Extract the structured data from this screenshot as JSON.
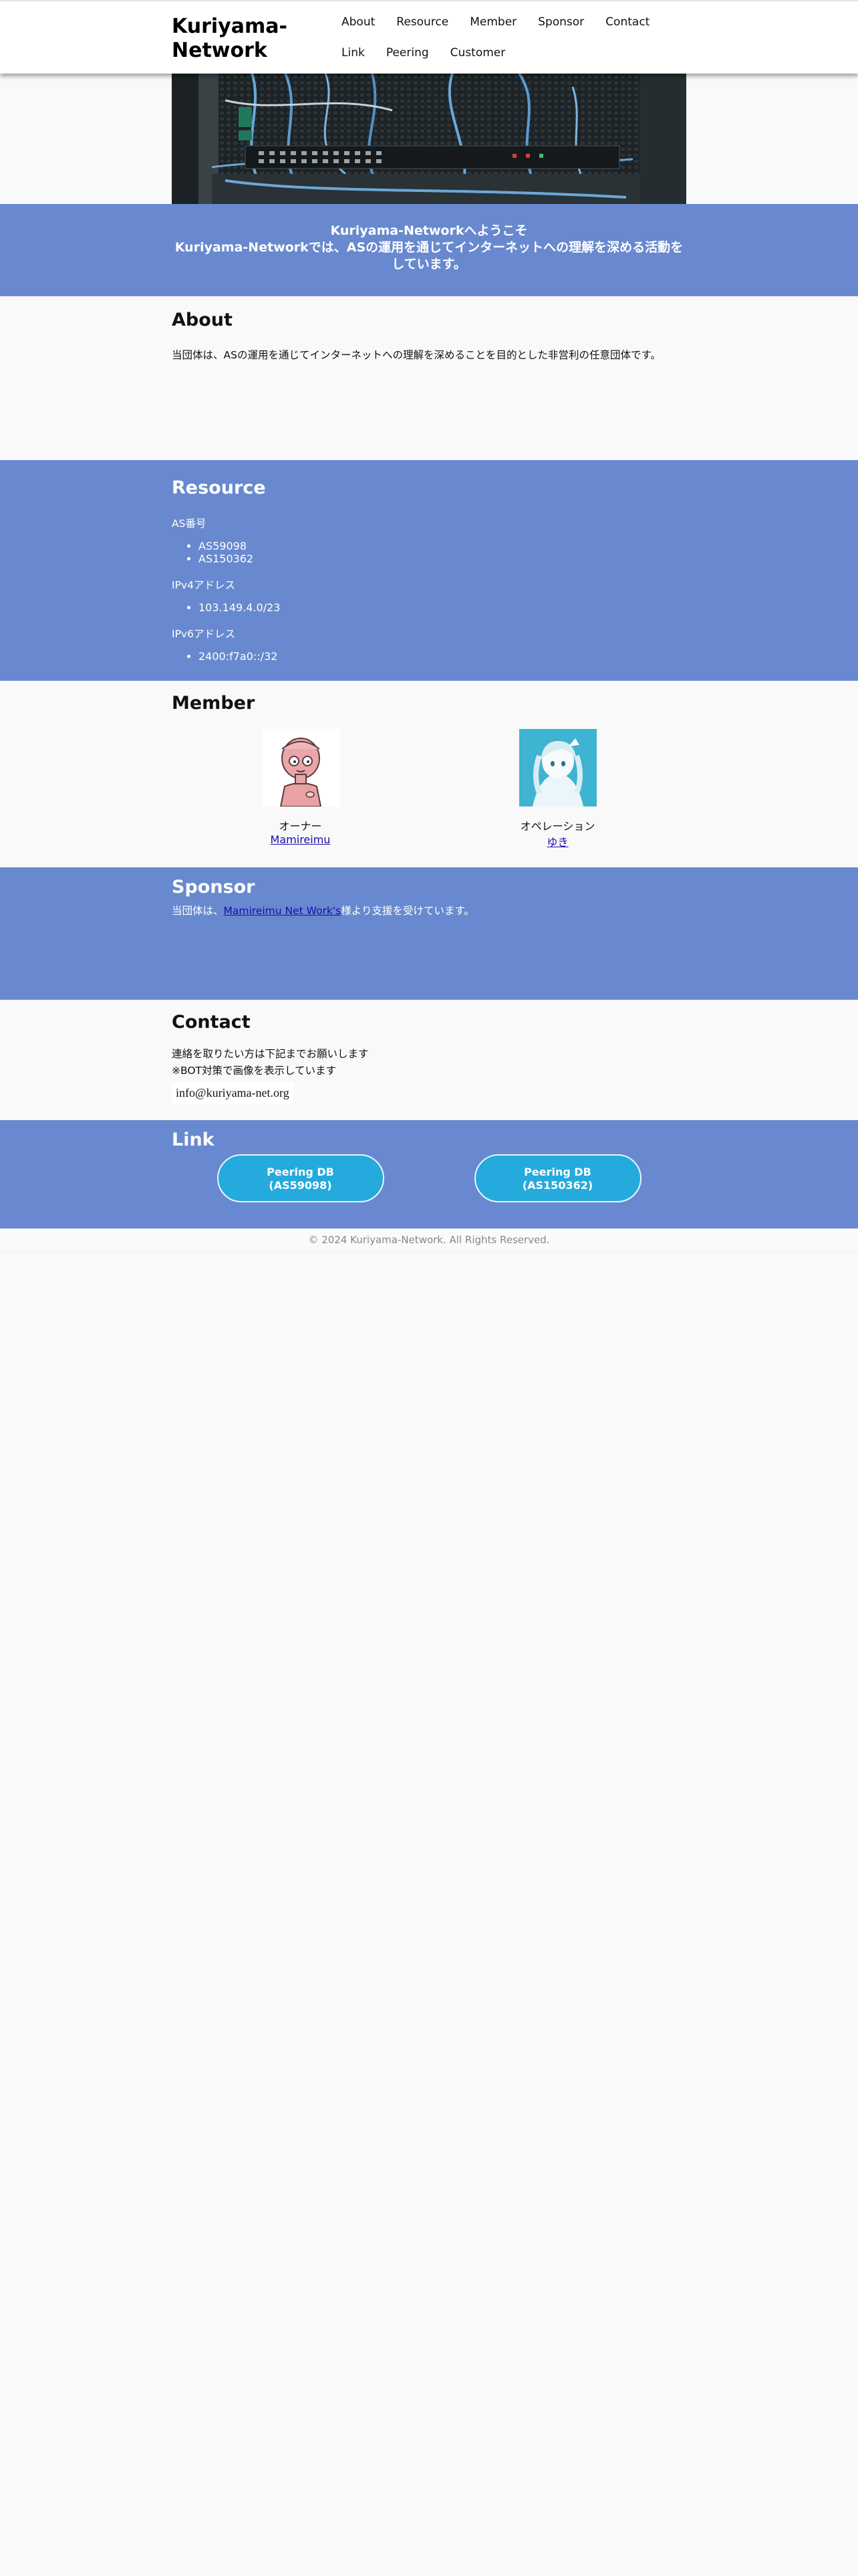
{
  "site": {
    "title": "Kuriyama-\nNetwork",
    "brand_color": "#6889cf",
    "button_color": "#25aadd"
  },
  "nav": [
    {
      "label": "About"
    },
    {
      "label": "Resource"
    },
    {
      "label": "Member"
    },
    {
      "label": "Sponsor"
    },
    {
      "label": "Contact"
    },
    {
      "label": "Link"
    },
    {
      "label": "Peering"
    },
    {
      "label": "Customer"
    }
  ],
  "welcome": {
    "line1": "Kuriyama-Networkへようこそ",
    "line2": "Kuriyama-Networkでは、ASの運用を通じてインターネットへの理解を深める活動をしています。"
  },
  "about": {
    "heading": "About",
    "text": "当団体は、ASの運用を通じてインターネットへの理解を深めることを目的とした非営利の任意団体です。"
  },
  "resource": {
    "heading": "Resource",
    "as_label": "AS番号",
    "as_numbers": [
      "AS59098",
      "AS150362"
    ],
    "ipv4_label": "IPv4アドレス",
    "ipv4": [
      "103.149.4.0/23"
    ],
    "ipv6_label": "IPv6アドレス",
    "ipv6": [
      "2400:f7a0::/32"
    ]
  },
  "member": {
    "heading": "Member",
    "people": [
      {
        "role": "オーナー",
        "name": "Mamireimu",
        "avatar": "bald-character-avatar"
      },
      {
        "role": "オペレーション",
        "name": "ゆき",
        "avatar": "anime-girl-avatar"
      }
    ]
  },
  "sponsor": {
    "heading": "Sponsor",
    "text_before": "当団体は、",
    "sponsor_name": "Mamireimu Net Work's",
    "text_after": "様より支援を受けています。"
  },
  "contact": {
    "heading": "Contact",
    "line1": "連絡を取りたい方は下記までお願いします",
    "line2": "※BOT対策で画像を表示しています",
    "email_image_text": "info@kuriyama-net.org"
  },
  "links": {
    "heading": "Link",
    "buttons": [
      {
        "line1": "Peering DB",
        "line2": "(AS59098)"
      },
      {
        "line1": "Peering DB",
        "line2": "(AS150362)"
      }
    ]
  },
  "footer": {
    "text": "© 2024 Kuriyama-Network. All Rights Reserved."
  }
}
